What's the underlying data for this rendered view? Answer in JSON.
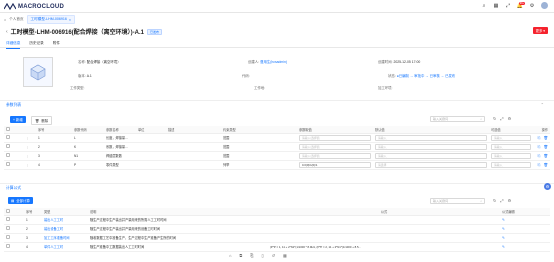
{
  "app": {
    "brand": "MACROCLOUD"
  },
  "breadcrumb": {
    "home": "个人首页",
    "current": "工时模型-LHM-006916"
  },
  "header_icons": {
    "notifications_badge": "99+"
  },
  "page": {
    "title": "工时模型-LHM-006916(配合焊接（离空环境）)-A.1",
    "tag": "已发布",
    "more_button": "更多 ▾"
  },
  "tabs": [
    "详细信息",
    "历史记录",
    "附件"
  ],
  "info": {
    "name_label": "名称:",
    "name_value": "配合焊接（离空环境）",
    "creator_label": "创建人:",
    "creator_value": "曹用生(hcsadmin)",
    "created_label": "创建时间:",
    "created_value": "2025-12-05 17:00",
    "version_label": "版本:",
    "version_value": "A.1",
    "code_label": "代码:",
    "code_value": "",
    "state_label": "状态:",
    "state_value": "●已编制 → 审批中 → 已审核 → 已发布",
    "worktype_label": "工作类型:",
    "worktype_value": "",
    "workshop_label": "工作地:",
    "workshop_value": "",
    "station_label": "加工环境:",
    "station_value": ""
  },
  "params_section": {
    "title": "参数列表",
    "new_button": "+ 新增",
    "delete_button": "删除",
    "search_placeholder": "输入关键词",
    "columns": [
      "序号",
      "参数代码",
      "参数名称",
      "单位",
      "描述",
      "约束类型",
      "参数取值",
      "默认值",
      "可选值",
      "操作"
    ],
    "rows": [
      {
        "no": "1",
        "code": "L",
        "name": "长度，焊接量...",
        "unit": "",
        "desc": "",
        "constraint": "范围",
        "value": "请输入/选择值",
        "default": "请输入",
        "options": "请输入"
      },
      {
        "no": "2",
        "code": "K",
        "name": "系数，焊接量...",
        "unit": "",
        "desc": "",
        "constraint": "范围",
        "value": "请输入/选择值",
        "default": "请输入",
        "options": "请输入"
      },
      {
        "no": "3",
        "code": "N1",
        "name": "焊缝层数数",
        "unit": "",
        "desc": "",
        "constraint": "范围",
        "value": "请输入/选择值",
        "default": "请输入",
        "options": "请输入"
      },
      {
        "no": "4",
        "code": "P",
        "name": "零件类型",
        "unit": "",
        "desc": "",
        "constraint": "列举",
        "value": "0.0(0)/1(0)/1",
        "default": "请选择",
        "options": "请输入"
      }
    ]
  },
  "formula_section": {
    "title": "计算公式",
    "add_button": "全部计算",
    "search_placeholder": "输入关键词",
    "columns": [
      "序号",
      "类型",
      "说明",
      "公式",
      "公式编辑"
    ],
    "rows": [
      {
        "no": "1",
        "type": "装出人工工时",
        "desc": "随生产过程中生产装出并产量用来的所需人工工时时间",
        "formula": ""
      },
      {
        "no": "2",
        "type": "装出设备工时",
        "desc": "随生产过程中生产装出并产量用来的设备工时时间",
        "formula": ""
      },
      {
        "no": "3",
        "type": "加工工序准备时间",
        "desc": "随着数据工艺中准备生产，生产过程中生产准备产生所的时间",
        "formula": ""
      },
      {
        "no": "4",
        "type": "单件人工工时",
        "desc": "随生产准备中工数据装出人工工时时间",
        "formula": "(P*P = 1, 11 + 2*N1*(1/1000 * 8.9H1, (P*P = 2, 11 + 2*N1*(1/1000 + 8.5..."
      }
    ]
  }
}
